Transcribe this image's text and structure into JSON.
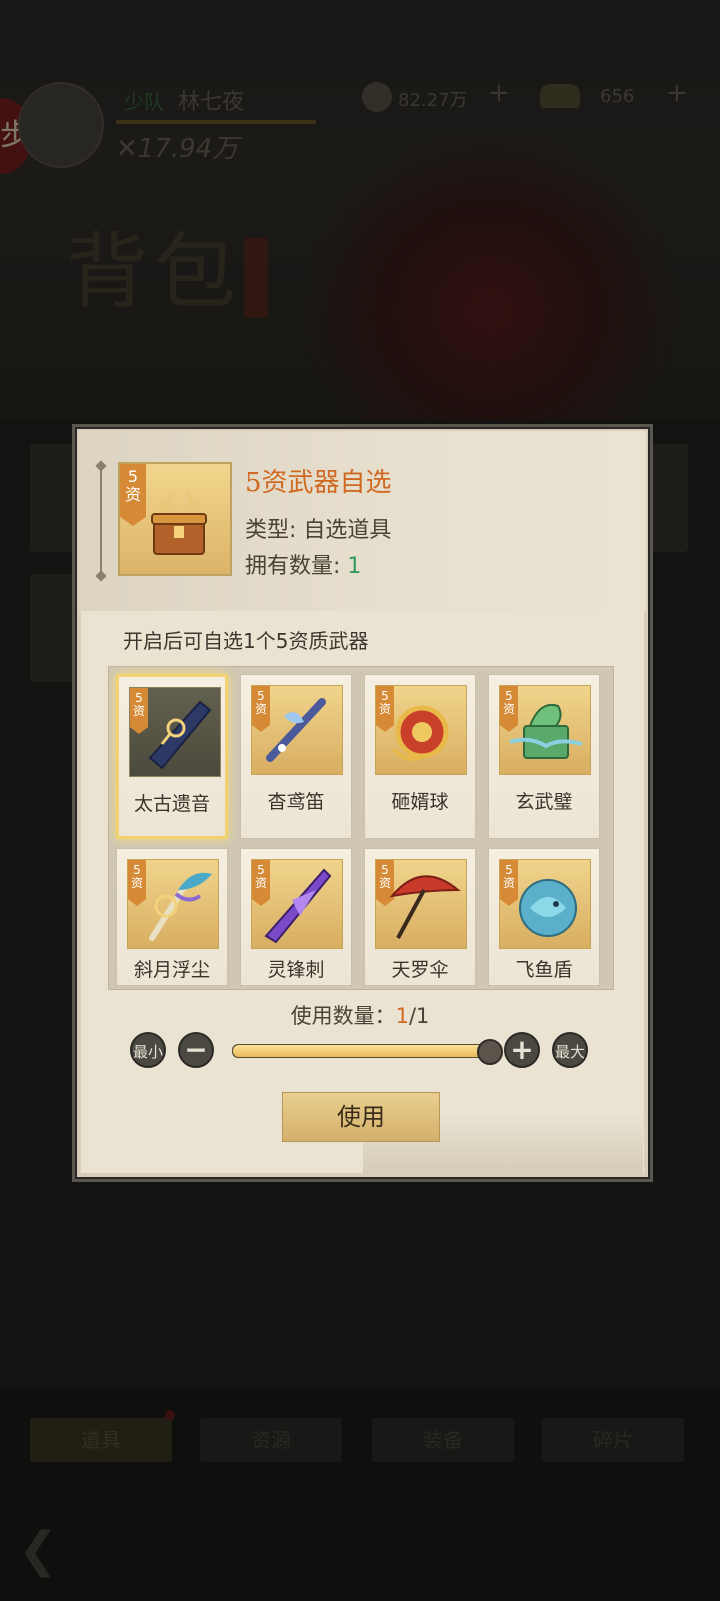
{
  "hud": {
    "player_rank": "少队",
    "player_name": "林七夜",
    "combat_power": "✕17.94万",
    "currency1_value": "82.27万",
    "currency2_value": "656",
    "plus_label": "+"
  },
  "page": {
    "title": "背包",
    "side_seal": "步"
  },
  "bottom_tabs": [
    {
      "label": "道具"
    },
    {
      "label": "资源"
    },
    {
      "label": "装备"
    },
    {
      "label": "碎片"
    }
  ],
  "dialog": {
    "item_rank": "5资",
    "item_title": "5资武器自选",
    "type_label": "类型: 自选道具",
    "own_label": "拥有数量: ",
    "own_count": "1",
    "description": "开启后可自选1个5资质武器",
    "options": [
      {
        "name": "太古遗音",
        "rank": "5资",
        "selected": true
      },
      {
        "name": "杳鸢笛",
        "rank": "5资",
        "selected": false
      },
      {
        "name": "砸婿球",
        "rank": "5资",
        "selected": false
      },
      {
        "name": "玄武璧",
        "rank": "5资",
        "selected": false
      },
      {
        "name": "斜月浮尘",
        "rank": "5资",
        "selected": false
      },
      {
        "name": "灵锋刺",
        "rank": "5资",
        "selected": false
      },
      {
        "name": "天罗伞",
        "rank": "5资",
        "selected": false
      },
      {
        "name": "飞鱼盾",
        "rank": "5资",
        "selected": false
      }
    ],
    "use_count_label": "使用数量：",
    "use_count_current": "1",
    "use_count_total": "/1",
    "slider_fraction": 1.0,
    "min_label": "最小",
    "max_label": "最大",
    "minus_label": "−",
    "plus_label": "+",
    "use_button": "使用"
  },
  "colors": {
    "accent_orange": "#d06a22",
    "own_green": "#2f9a5a",
    "gold": "#eab858"
  }
}
